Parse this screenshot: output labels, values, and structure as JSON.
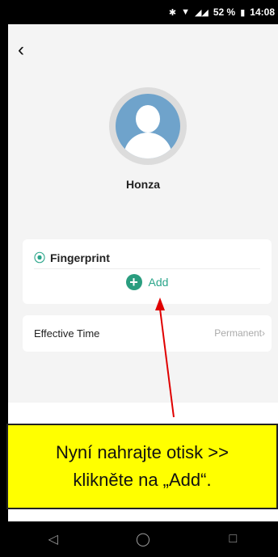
{
  "status_bar": {
    "battery": "52 %",
    "time": "14:08"
  },
  "profile": {
    "name": "Honza"
  },
  "fingerprint_card": {
    "title": "Fingerprint",
    "add_label": "Add"
  },
  "effective_time": {
    "label": "Effective Time",
    "value": "Permanent"
  },
  "callout": {
    "text": "Nyní nahrajte otisk >>\nklikněte na „Add“."
  },
  "colors": {
    "accent": "#2aa58a",
    "callout_bg": "#ffff00",
    "arrow": "#e00000"
  }
}
